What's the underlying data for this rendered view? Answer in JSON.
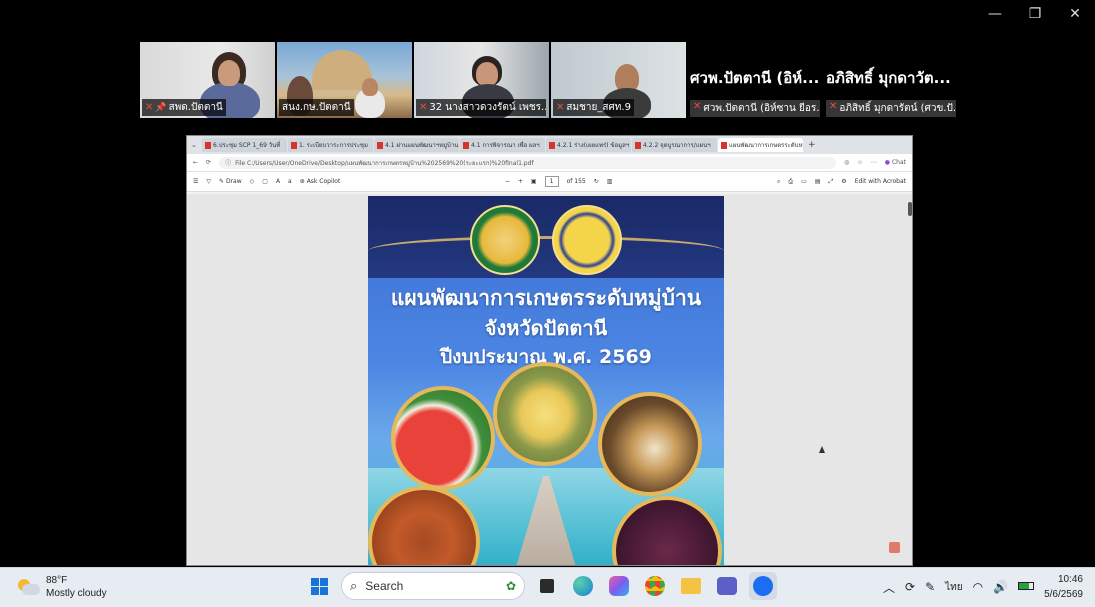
{
  "window_controls": {
    "minimize": "—",
    "restore": "❐",
    "close": "✕"
  },
  "participants": [
    {
      "name": "สพด.ปัตตานี",
      "mic": "muted",
      "pinned": true
    },
    {
      "name": "สนง.กษ.ปัตตานี",
      "mic": "on",
      "active": true
    },
    {
      "name": "32 นางสาวดวงรัตน์ เพชร...",
      "mic": "muted"
    },
    {
      "name": "สมชาย_สศท.9",
      "mic": "muted"
    }
  ],
  "text_tiles": [
    {
      "display": "ศวพ.ปัตตานี (อิห์...",
      "name": "ศวพ.ปัตตานี (อิห์ซาน ยีอร..."
    },
    {
      "display": "อภิสิทธิ์ มุกดาวัต...",
      "name": "อภิสิทธิ์ มุกดารัตน์ (ศวข.ปั..."
    }
  ],
  "browser": {
    "tabs": [
      {
        "label": "6.ประชุม SCP 1_69 วันที่"
      },
      {
        "label": "1. ระเบียบวาระการประชุม"
      },
      {
        "label": "4.1 ผ่านแผนพัฒนาฯหมู่บ้าน"
      },
      {
        "label": "4.1 การพิจารณา เพื่อ ผลฯ"
      },
      {
        "label": "4.2.1 ร่าง(เผยแพร่) ข้อมูลฯ"
      },
      {
        "label": "4.2.2 จุดบูรณาการ/แผนฯ"
      },
      {
        "label": "แผนพัฒนาการเกษตรระดับหมู่บ้าน 2.5",
        "active": true
      }
    ],
    "new_tab": "+",
    "address": "File  C:/Users/User/OneDrive/Desktop/แผนพัฒนาการเกษตรหมู่บ้าน%202569%20(ระยะแรก)%20final1.pdf",
    "chat_label": "Chat",
    "toolbar": {
      "draw": "Draw",
      "ask_copilot": "Ask Copilot",
      "zoom_out": "−",
      "zoom_in": "+",
      "page_current": "1",
      "page_total": "of 155",
      "edit_acrobat": "Edit with Acrobat"
    }
  },
  "pdf_cover": {
    "line1": "แผนพัฒนาการเกษตรระดับหมู่บ้าน",
    "line2": "จังหวัดปัตตานี",
    "line3": "ปีงบประมาณ พ.ศ. 2569"
  },
  "taskbar": {
    "weather_temp": "88°F",
    "weather_desc": "Mostly cloudy",
    "search_placeholder": "Search",
    "language": "ไทย",
    "time": "10:46",
    "date": "5/6/2569"
  }
}
